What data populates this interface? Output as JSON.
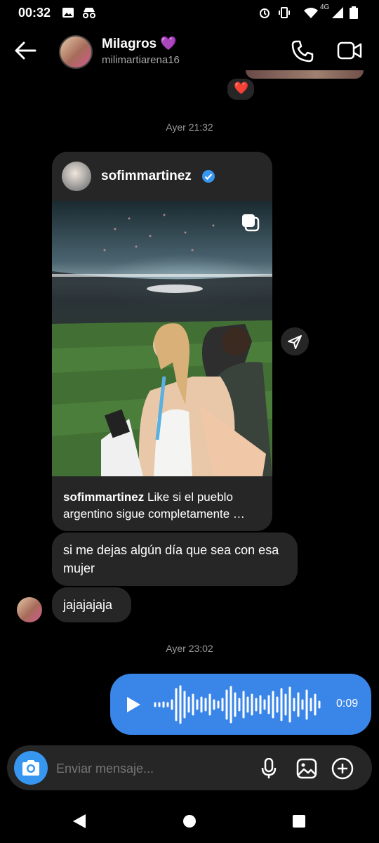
{
  "status_bar": {
    "time": "00:32",
    "network": "4G"
  },
  "header": {
    "name": "Milagros",
    "name_emoji": "💜",
    "username": "milimartiarena16"
  },
  "reaction": {
    "emoji": "❤️"
  },
  "timestamps": [
    "Ayer 21:32",
    "Ayer 23:02"
  ],
  "shared_post": {
    "username": "sofimmartinez",
    "caption": "Like si el pueblo argentino sigue completamente …"
  },
  "messages": [
    {
      "text": "si me dejas algún día que sea con esa mujer"
    },
    {
      "text": "jajajajaja"
    }
  ],
  "voice_message": {
    "duration": "0:09"
  },
  "composer": {
    "placeholder": "Enviar mensaje..."
  },
  "colors": {
    "background": "#000000",
    "bubble": "#262626",
    "outgoing": "#3a85e8",
    "accent": "#3797f0"
  },
  "icons": [
    "back-arrow-icon",
    "phone-icon",
    "video-call-icon",
    "heart-icon",
    "verified-badge-icon",
    "carousel-icon",
    "send-share-icon",
    "play-icon",
    "camera-icon",
    "microphone-icon",
    "gallery-icon",
    "plus-icon",
    "back-nav-icon",
    "home-nav-icon",
    "recents-nav-icon"
  ]
}
